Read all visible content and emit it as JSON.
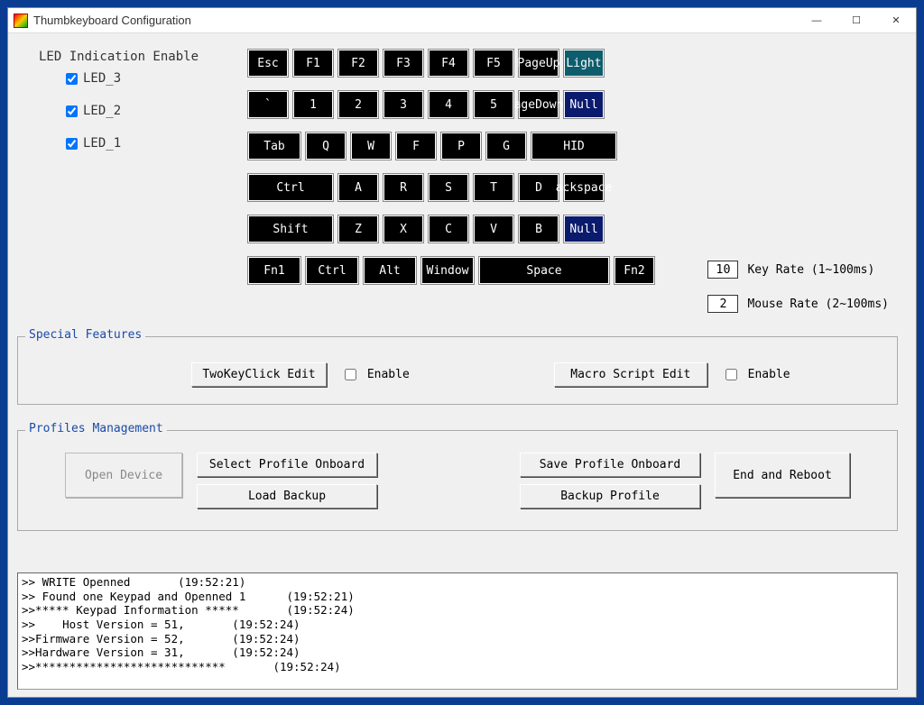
{
  "window": {
    "title": "Thumbkeyboard Configuration"
  },
  "led": {
    "title": "LED Indication Enable",
    "items": [
      {
        "label": "LED_3",
        "checked": true
      },
      {
        "label": "LED_2",
        "checked": true
      },
      {
        "label": "LED_1",
        "checked": true
      }
    ]
  },
  "keyboard": {
    "rows": [
      [
        {
          "label": "Esc",
          "w": "w44"
        },
        {
          "label": "F1",
          "w": "w44"
        },
        {
          "label": "F2",
          "w": "w44"
        },
        {
          "label": "F3",
          "w": "w44"
        },
        {
          "label": "F4",
          "w": "w44"
        },
        {
          "label": "F5",
          "w": "w44"
        },
        {
          "label": "PageUp",
          "w": "w44"
        },
        {
          "label": "Light",
          "w": "w44",
          "cls": "alt1"
        }
      ],
      [
        {
          "label": "`",
          "w": "w44"
        },
        {
          "label": "1",
          "w": "w44"
        },
        {
          "label": "2",
          "w": "w44"
        },
        {
          "label": "3",
          "w": "w44"
        },
        {
          "label": "4",
          "w": "w44"
        },
        {
          "label": "5",
          "w": "w44"
        },
        {
          "label": "ageDown",
          "w": "w44"
        },
        {
          "label": "Null",
          "w": "w44",
          "cls": "alt2"
        }
      ],
      [
        {
          "label": "Tab",
          "w": "w58"
        },
        {
          "label": "Q",
          "w": "w44"
        },
        {
          "label": "W",
          "w": "w44"
        },
        {
          "label": "F",
          "w": "w44"
        },
        {
          "label": "P",
          "w": "w44"
        },
        {
          "label": "G",
          "w": "w44"
        },
        {
          "label": "HID",
          "w": "w94"
        }
      ],
      [
        {
          "label": "Ctrl",
          "w": "w94"
        },
        {
          "label": "A",
          "w": "w44"
        },
        {
          "label": "R",
          "w": "w44"
        },
        {
          "label": "S",
          "w": "w44"
        },
        {
          "label": "T",
          "w": "w44"
        },
        {
          "label": "D",
          "w": "w44"
        },
        {
          "label": "ackspace",
          "w": "w44"
        }
      ],
      [
        {
          "label": "Shift",
          "w": "w94"
        },
        {
          "label": "Z",
          "w": "w44"
        },
        {
          "label": "X",
          "w": "w44"
        },
        {
          "label": "C",
          "w": "w44"
        },
        {
          "label": "V",
          "w": "w44"
        },
        {
          "label": "B",
          "w": "w44"
        },
        {
          "label": "Null",
          "w": "w44",
          "cls": "alt2"
        }
      ],
      [
        {
          "label": "Fn1",
          "w": "w58"
        },
        {
          "label": "Ctrl",
          "w": "w58"
        },
        {
          "label": "Alt",
          "w": "w58"
        },
        {
          "label": "Window",
          "w": "w58"
        },
        {
          "label": "Space",
          "w": "w144"
        },
        {
          "label": "Fn2",
          "w": "w44"
        }
      ]
    ]
  },
  "rates": {
    "key": {
      "value": "10",
      "label": "Key Rate (1~100ms)"
    },
    "mouse": {
      "value": "2",
      "label": "Mouse Rate (2~100ms)"
    }
  },
  "special": {
    "legend": "Special Features",
    "twokey_btn": "TwoKeyClick Edit",
    "twokey_enable": "Enable",
    "macro_btn": "Macro Script Edit",
    "macro_enable": "Enable"
  },
  "profiles": {
    "legend": "Profiles Management",
    "open_device": "Open Device",
    "select_onboard": "Select Profile Onboard",
    "load_backup": "Load Backup",
    "save_onboard": "Save Profile Onboard",
    "backup_profile": "Backup Profile",
    "end_reboot": "End and Reboot"
  },
  "console": ">> WRITE Openned       (19:52:21)\n>> Found one Keypad and Openned 1      (19:52:21)\n>>***** Keypad Information *****       (19:52:24)\n>>    Host Version = 51,       (19:52:24)\n>>Firmware Version = 52,       (19:52:24)\n>>Hardware Version = 31,       (19:52:24)\n>>****************************       (19:52:24)"
}
